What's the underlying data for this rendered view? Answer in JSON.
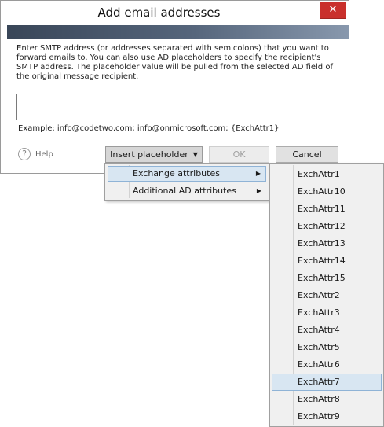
{
  "dialog": {
    "title": "Add email addresses",
    "close_label": "✕",
    "description": "Enter SMTP address (or addresses separated with semicolons) that you want to forward emails to. You can also use AD placeholders to specify the recipient's SMTP address. The placeholder value will be pulled from the selected AD field of the original message recipient.",
    "address_value": "",
    "example": "Example: info@codetwo.com; info@onmicrosoft.com; {ExchAttr1}",
    "help_icon": "?",
    "help_label": "Help",
    "insert_placeholder_label": "Insert placeholder",
    "ok_label": "OK",
    "cancel_label": "Cancel"
  },
  "menu": {
    "items": [
      {
        "label": "Exchange attributes",
        "highlighted": true
      },
      {
        "label": "Additional AD attributes",
        "highlighted": false
      }
    ],
    "submenu_arrow_icon": "▶",
    "submenu": [
      "ExchAttr1",
      "ExchAttr10",
      "ExchAttr11",
      "ExchAttr12",
      "ExchAttr13",
      "ExchAttr14",
      "ExchAttr15",
      "ExchAttr2",
      "ExchAttr3",
      "ExchAttr4",
      "ExchAttr5",
      "ExchAttr6",
      "ExchAttr7",
      "ExchAttr8",
      "ExchAttr9"
    ],
    "submenu_highlighted": "ExchAttr7"
  },
  "colors": {
    "close_button": "#c9302c",
    "highlight": "#d8e6f2",
    "highlight_border": "#8fb3d6",
    "menu_background": "#f0f0f0"
  }
}
